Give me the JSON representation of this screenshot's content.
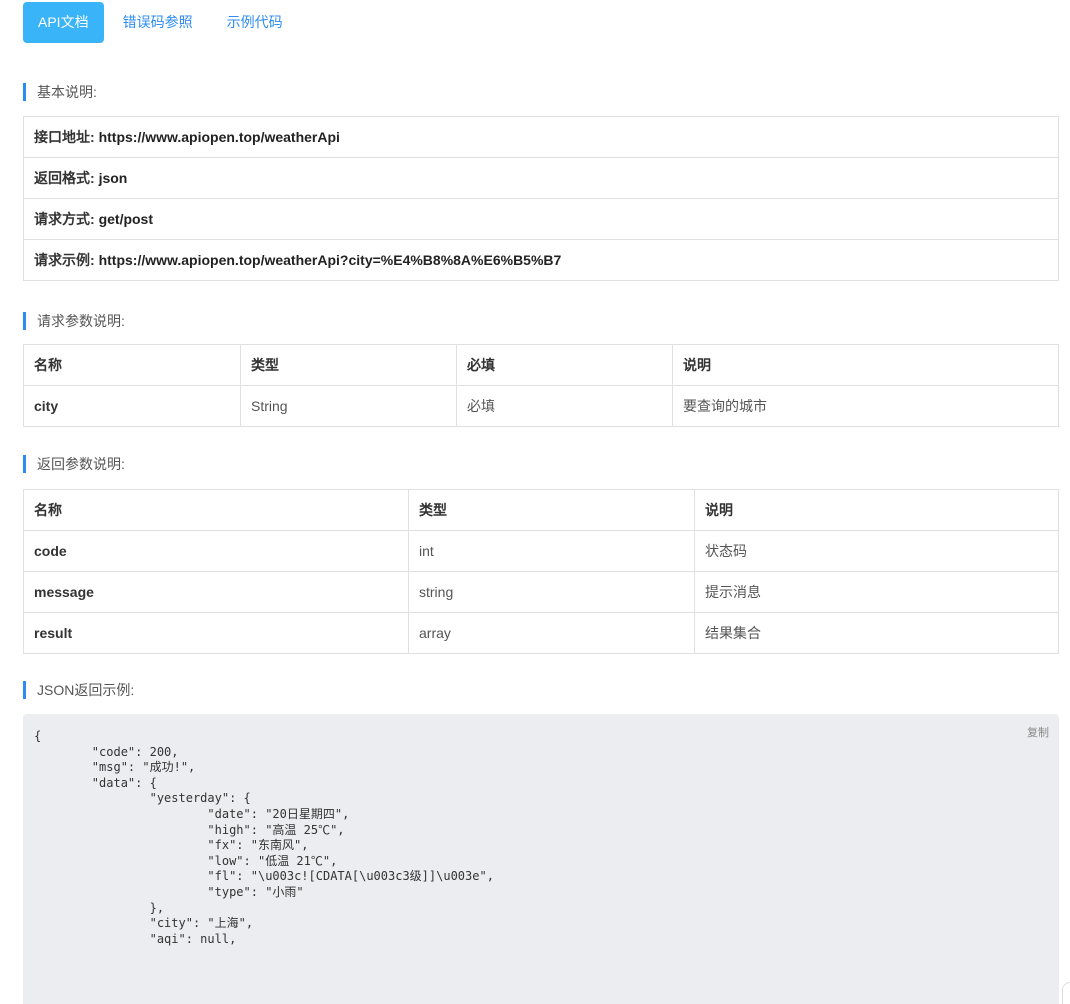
{
  "tabs": [
    {
      "label": "API文档",
      "active": true
    },
    {
      "label": "错误码参照",
      "active": false
    },
    {
      "label": "示例代码",
      "active": false
    }
  ],
  "sections": {
    "basic": "基本说明:",
    "request_params": "请求参数说明:",
    "response_params": "返回参数说明:",
    "json_example": "JSON返回示例:"
  },
  "basic_info": {
    "endpoint_label": "接口地址:",
    "endpoint_value": "https://www.apiopen.top/weatherApi",
    "format_label": "返回格式:",
    "format_value": "json",
    "method_label": "请求方式:",
    "method_value": "get/post",
    "example_label": "请求示例:",
    "example_value": "https://www.apiopen.top/weatherApi?city=%E4%B8%8A%E6%B5%B7"
  },
  "request_table": {
    "headers": [
      "名称",
      "类型",
      "必填",
      "说明"
    ],
    "rows": [
      [
        "city",
        "String",
        "必填",
        "要查询的城市"
      ]
    ]
  },
  "response_table": {
    "headers": [
      "名称",
      "类型",
      "说明"
    ],
    "rows": [
      [
        "code",
        "int",
        "状态码"
      ],
      [
        "message",
        "string",
        "提示消息"
      ],
      [
        "result",
        "array",
        "结果集合"
      ]
    ]
  },
  "code_example": {
    "copy_label": "复制",
    "text": "{\n\t\"code\": 200,\n\t\"msg\": \"成功!\",\n\t\"data\": {\n\t\t\"yesterday\": {\n\t\t\t\"date\": \"20日星期四\",\n\t\t\t\"high\": \"高温 25℃\",\n\t\t\t\"fx\": \"东南风\",\n\t\t\t\"low\": \"低温 21℃\",\n\t\t\t\"fl\": \"\\u003c![CDATA[\\u003c3级]]\\u003e\",\n\t\t\t\"type\": \"小雨\"\n\t\t},\n\t\t\"city\": \"上海\",\n\t\t\"aqi\": null,"
  }
}
